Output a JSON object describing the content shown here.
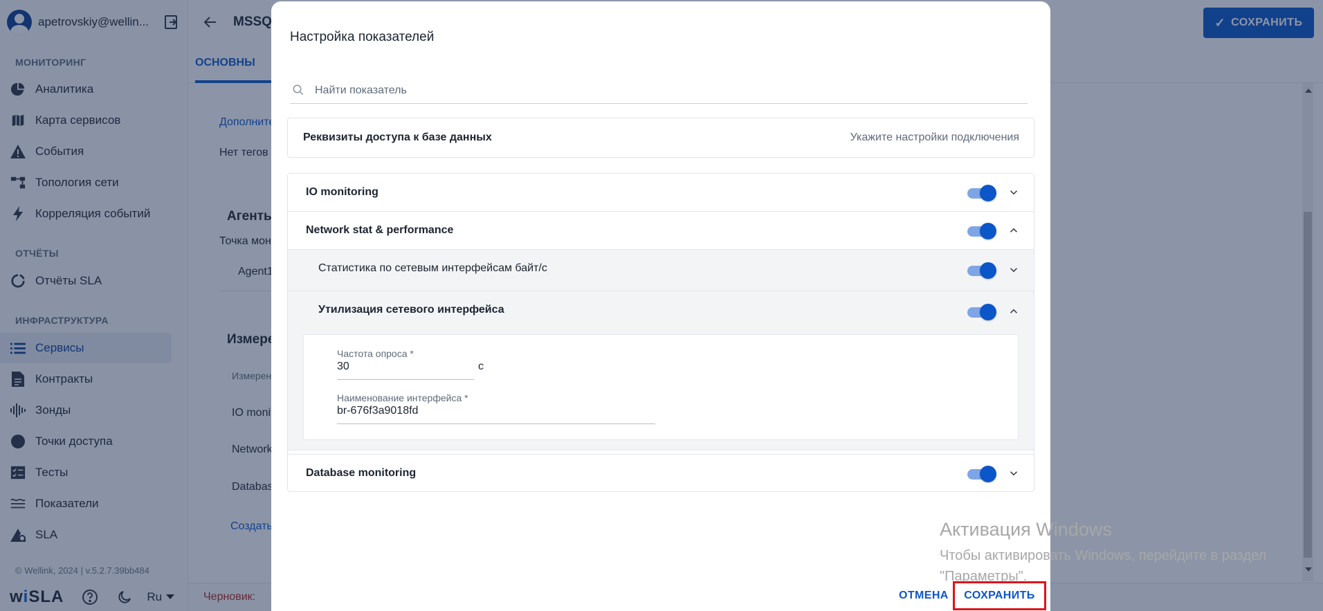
{
  "sidebar": {
    "user_email": "apetrovskiy@wellin...",
    "sections": {
      "monitoring": "МОНИТОРИНГ",
      "reports": "ОТЧЁТЫ",
      "infrastructure": "ИНФРАСТРУКТУРА"
    },
    "items": [
      {
        "label": "Аналитика",
        "icon": "pie-chart-icon"
      },
      {
        "label": "Карта сервисов",
        "icon": "map-icon"
      },
      {
        "label": "События",
        "icon": "warning-icon"
      },
      {
        "label": "Топология сети",
        "icon": "topology-icon"
      },
      {
        "label": "Корреляция событий",
        "icon": "bolt-icon"
      },
      {
        "label": "Отчёты SLA",
        "icon": "sla-report-icon"
      },
      {
        "label": "Сервисы",
        "icon": "list-icon",
        "active": true
      },
      {
        "label": "Контракты",
        "icon": "document-icon"
      },
      {
        "label": "Зонды",
        "icon": "probe-icon"
      },
      {
        "label": "Точки доступа",
        "icon": "circle-icon"
      },
      {
        "label": "Тесты",
        "icon": "tests-icon"
      },
      {
        "label": "Показатели",
        "icon": "metrics-icon"
      },
      {
        "label": "SLA",
        "icon": "sla-icon"
      }
    ],
    "copyright": "© Wellink, 2024 | v.5.2.7.39bb484",
    "brand": {
      "w": "w",
      "i": "i",
      "sla": "SLA"
    },
    "language": "Ru"
  },
  "header": {
    "title": "MSSQL",
    "save_label": "СОХРАНИТЬ"
  },
  "tabs": {
    "main": "ОСНОВНЫ"
  },
  "background": {
    "additional": "Дополните",
    "no_tags": "Нет тегов",
    "agents": "Агенты",
    "monitoring_point": "Точка мон",
    "agent1": "Agent1",
    "measurements": "Измере",
    "measure_col": "Измерен",
    "io": "IO monit",
    "network": "Network",
    "database": "Databas",
    "create": "Создать",
    "draft": "Черновик:"
  },
  "modal": {
    "title": "Настройка показателей",
    "search_placeholder": "Найти показатель",
    "credentials": {
      "title": "Реквизиты доступа к базе данных",
      "hint": "Укажите настройки подключения"
    },
    "metrics": [
      {
        "name": "IO monitoring",
        "enabled": true,
        "expanded": false
      },
      {
        "name": "Network stat & performance",
        "enabled": true,
        "expanded": true
      },
      {
        "name": "Database monitoring",
        "enabled": true,
        "expanded": false
      }
    ],
    "sub_metrics": [
      {
        "name": "Статистика по сетевым интерфейсам байт/с",
        "enabled": true,
        "expanded": false
      },
      {
        "name": "Утилизация сетевого интерфейса",
        "enabled": true,
        "expanded": true
      }
    ],
    "fields": {
      "poll_label": "Частота опроса *",
      "poll_value": "30",
      "poll_unit": "с",
      "iface_label": "Наименование интерфейса *",
      "iface_value": "br-676f3a9018fd"
    },
    "cancel_label": "ОТМЕНА",
    "save_label": "СОХРАНИТЬ"
  },
  "watermark": {
    "title": "Активация Windows",
    "text": "Чтобы активировать Windows, перейдите в раздел \"Параметры\"."
  },
  "colors": {
    "accent": "#0b56c8",
    "highlight": "#e0121b",
    "draft": "#b3261e"
  }
}
